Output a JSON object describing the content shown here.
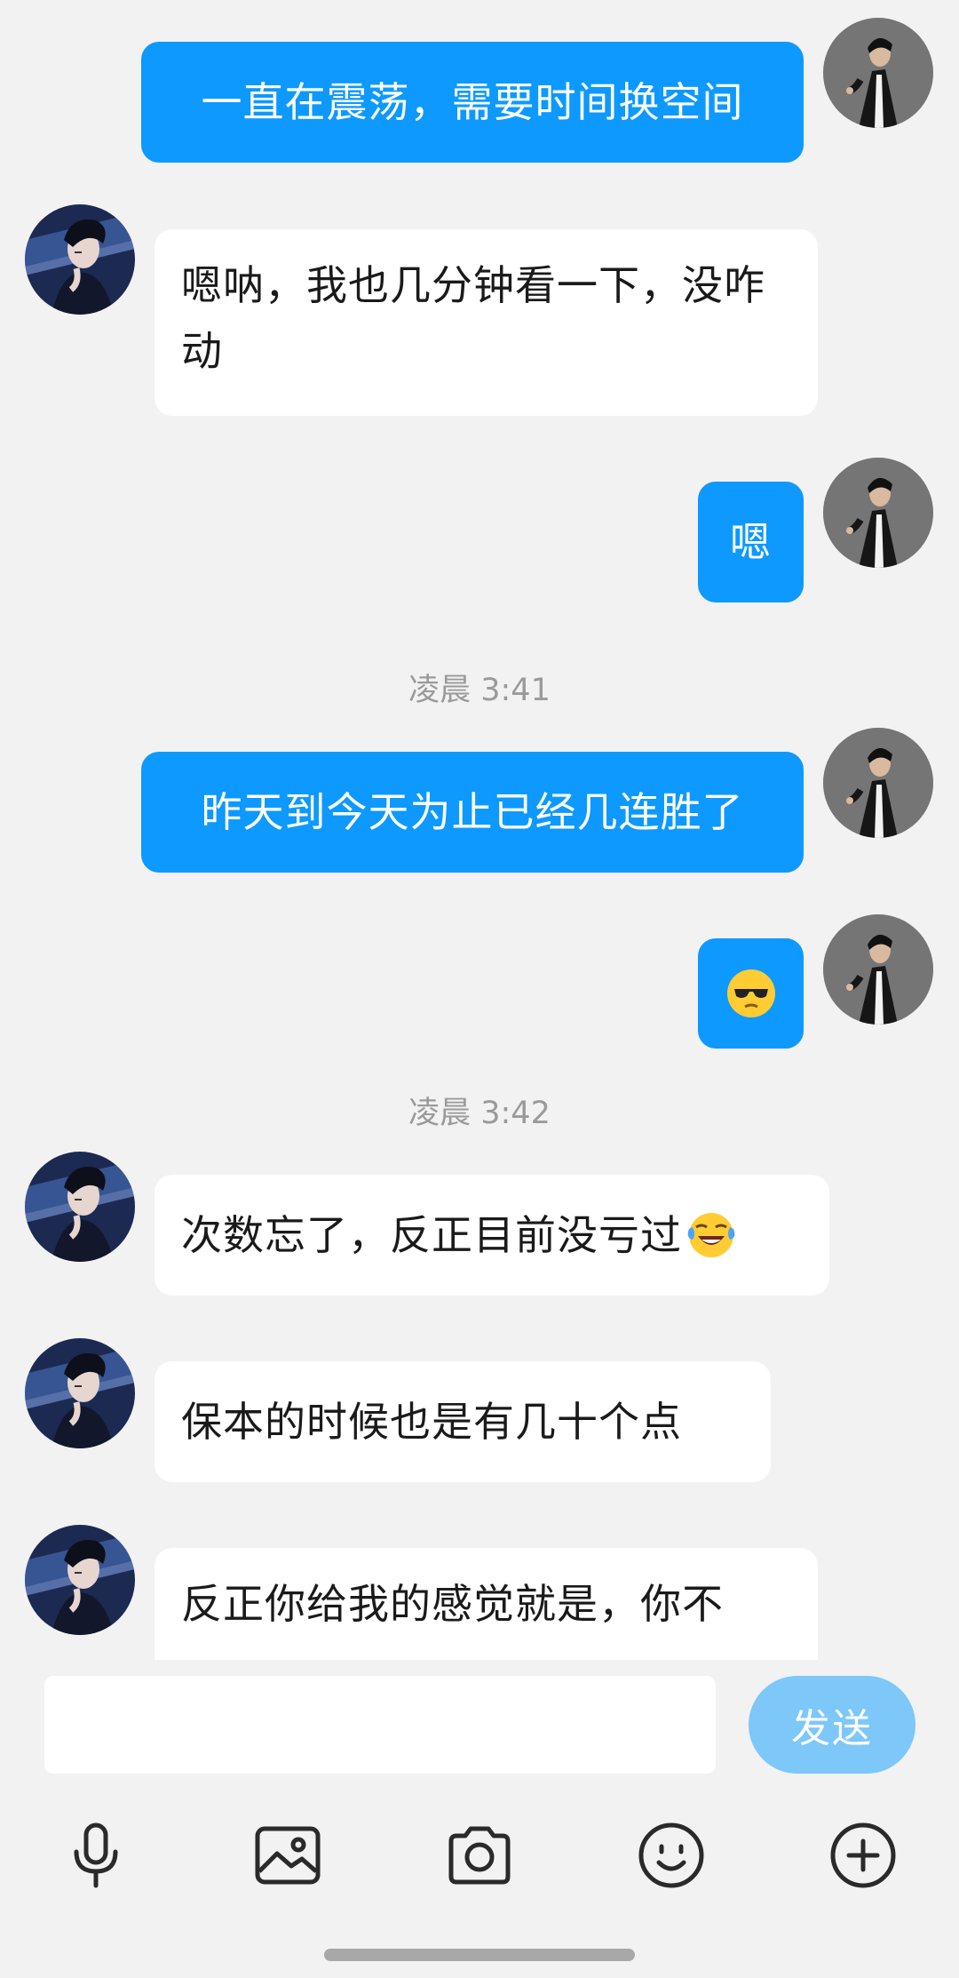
{
  "messages": [
    {
      "side": "out",
      "text": "一直在震荡，需要时间换空间"
    },
    {
      "side": "in",
      "text": "嗯呐，我也几分钟看一下，没咋动"
    },
    {
      "side": "out",
      "text": "嗯"
    },
    {
      "side": "time",
      "text": "凌晨 3:41"
    },
    {
      "side": "out",
      "text": "昨天到今天为止已经几连胜了"
    },
    {
      "side": "out",
      "emoji": "sunglasses-emoji"
    },
    {
      "side": "time",
      "text": "凌晨 3:42"
    },
    {
      "side": "in",
      "text": "次数忘了，反正目前没亏过",
      "emoji": "tears-of-joy-emoji"
    },
    {
      "side": "in",
      "text": "保本的时候也是有几十个点"
    },
    {
      "side": "in",
      "text": "反正你给我的感觉就是，你不"
    }
  ],
  "composer": {
    "input_value": "",
    "send_label": "发送"
  },
  "toolbar": {
    "icons": [
      "microphone-icon",
      "image-icon",
      "camera-icon",
      "emoji-icon",
      "plus-icon"
    ]
  },
  "colors": {
    "background": "#f2f2f2",
    "outgoing_bubble": "#0d99ff",
    "incoming_bubble": "#ffffff",
    "send_button": "#7dc7f9",
    "timestamp_text": "#9a9a9a"
  }
}
